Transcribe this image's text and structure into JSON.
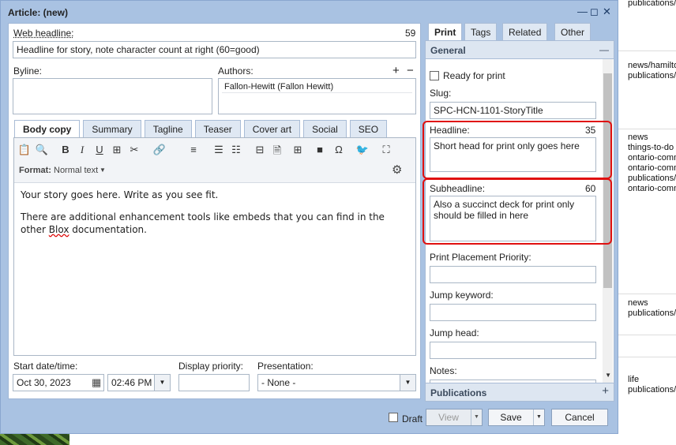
{
  "background": {
    "col1": [
      "publications/"
    ],
    "col2": [
      "news/hamilto",
      "publications/"
    ],
    "col3": [
      "news",
      "things-to-do",
      "ontario-comm",
      "ontario-comm",
      "publications/",
      "ontario-comm"
    ],
    "col4": [
      "news",
      "publications/"
    ],
    "col5": [
      "life",
      "publications/"
    ]
  },
  "window": {
    "title": "Article: (new)",
    "min": "—",
    "max": "◻",
    "close": "✕"
  },
  "left": {
    "web_headline_label": "Web headline:",
    "web_headline_count": "59",
    "web_headline_value": "Headline for story, note character count at right (60=good)",
    "byline_label": "Byline:",
    "authors_label": "Authors:",
    "authors_add": "+",
    "authors_remove": "−",
    "author_value": "Fallon-Hewitt (Fallon Hewitt)",
    "tabs": [
      "Body copy",
      "Summary",
      "Tagline",
      "Teaser",
      "Cover art",
      "Social",
      "SEO"
    ],
    "format_label": "Format:",
    "format_value": "Normal text",
    "body_p1": "Your story goes here. Write as you see fit.",
    "body_p2_a": "There are additional enhancement tools like embeds that you can find in the other ",
    "body_p2_b": "Blox",
    "body_p2_c": " documentation.",
    "start_label": "Start date/time:",
    "start_date": "Oct 30, 2023",
    "start_time": "02:46 PM",
    "priority_label": "Display priority:",
    "presentation_label": "Presentation:",
    "presentation_value": "- None -"
  },
  "right": {
    "tabs": [
      "Print",
      "Tags",
      "Related",
      "Other"
    ],
    "general_label": "General",
    "general_toggle": "—",
    "ready_label": "Ready for print",
    "slug_label": "Slug:",
    "slug_value": "SPC-HCN-1101-StoryTitle",
    "headline_label": "Headline:",
    "headline_count": "35",
    "headline_value": "Short head for print only goes here",
    "subheadline_label": "Subheadline:",
    "subheadline_count": "60",
    "subheadline_value": "Also a succinct deck for print only should be filled in here",
    "placement_label": "Print Placement Priority:",
    "jump_keyword_label": "Jump keyword:",
    "jump_head_label": "Jump head:",
    "notes_label": "Notes:",
    "publications_label": "Publications",
    "publications_add": "+"
  },
  "footer": {
    "draft": "Draft",
    "view": "View",
    "save": "Save",
    "cancel": "Cancel"
  },
  "icons": {
    "clipboard": "📋",
    "find": "🔍",
    "bold": "B",
    "italic": "I",
    "underline": "U",
    "insert": "⊞",
    "cut": "✂",
    "link": "🔗",
    "align": "≡",
    "ol": "☰",
    "ul": "☷",
    "hr": "⊟",
    "doc": "🗎",
    "table": "⊞",
    "video": "■",
    "omega": "Ω",
    "twitter": "🐦",
    "fullscreen": "⛶",
    "gear": "⚙"
  }
}
